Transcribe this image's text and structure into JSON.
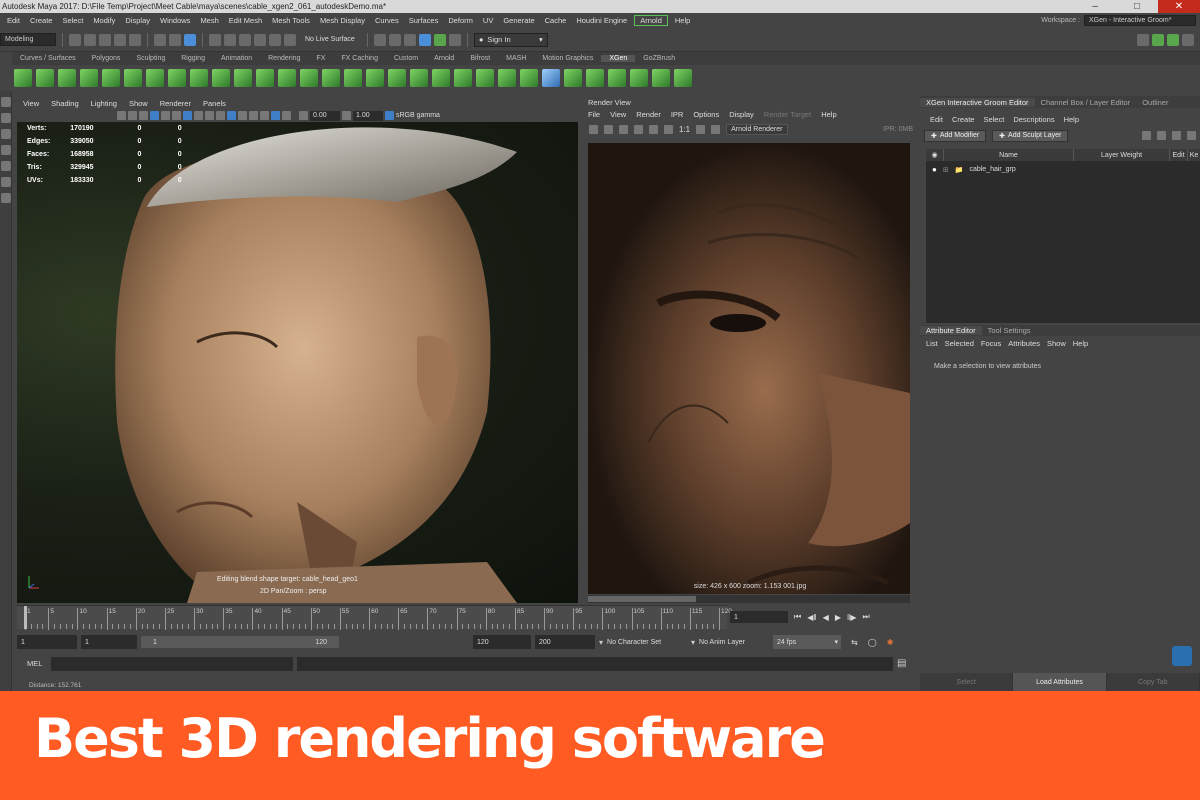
{
  "window": {
    "title": "Autodesk Maya 2017: D:\\File Temp\\Project\\Meet Cable\\maya\\scenes\\cable_xgen2_061_autodeskDemo.ma*"
  },
  "menubar": {
    "items": [
      "Edit",
      "Create",
      "Select",
      "Modify",
      "Display",
      "Windows",
      "Mesh",
      "Edit Mesh",
      "Mesh Tools",
      "Mesh Display",
      "Curves",
      "Surfaces",
      "Deform",
      "UV",
      "Generate",
      "Cache",
      "Houdini Engine"
    ],
    "arnold": "Arnold",
    "help": "Help",
    "workspace_label": "Workspace :",
    "workspace_value": "XGen - Interactive Groom*"
  },
  "statusline": {
    "mode": "Modeling",
    "live_surface": "No Live Surface",
    "sign_in": "Sign In"
  },
  "shelf": {
    "tabs": [
      "Curves / Surfaces",
      "Polygons",
      "Sculpting",
      "Rigging",
      "Animation",
      "Rendering",
      "FX",
      "FX Caching",
      "Custom",
      "Arnold",
      "Bifrost",
      "MASH",
      "Motion Graphics",
      "XGen",
      "GoZBrush"
    ],
    "active": "XGen"
  },
  "viewport": {
    "menu": [
      "View",
      "Shading",
      "Lighting",
      "Show",
      "Renderer",
      "Panels"
    ],
    "exposure": "0.00",
    "gamma": "1.00",
    "colorspace": "sRGB gamma",
    "hud": [
      {
        "label": "Verts:",
        "value": "170190",
        "a": "0",
        "b": "0"
      },
      {
        "label": "Edges:",
        "value": "339050",
        "a": "0",
        "b": "0"
      },
      {
        "label": "Faces:",
        "value": "168958",
        "a": "0",
        "b": "0"
      },
      {
        "label": "Tris:",
        "value": "329945",
        "a": "0",
        "b": "0"
      },
      {
        "label": "UVs:",
        "value": "183330",
        "a": "0",
        "b": "0"
      }
    ],
    "caption1": "Editing blend shape target: cable_head_geo1",
    "caption2": "2D Pan/Zoom : persp"
  },
  "renderview": {
    "title": "Render View",
    "menu": [
      "File",
      "View",
      "Render",
      "IPR",
      "Options",
      "Display",
      "Render Target",
      "Help"
    ],
    "ratio": "1:1",
    "renderer": "Arnold Renderer",
    "ipr": "IPR: 0MB",
    "status": "size: 426 x 600 zoom: 1.153 001.jpg"
  },
  "rightpanel": {
    "tabs": [
      "XGen Interactive Groom Editor",
      "Channel Box / Layer Editor",
      "Outliner"
    ],
    "menu": [
      "Edit",
      "Create",
      "Select",
      "Descriptions",
      "Help"
    ],
    "add_modifier": "Add Modifier",
    "add_sculpt_layer": "Add Sculpt Layer",
    "columns": [
      "Name",
      "Layer Weight",
      "Edit",
      "Ke"
    ],
    "item": "cable_hair_grp"
  },
  "attribute_editor": {
    "tabs": [
      "Attribute Editor",
      "Tool Settings"
    ],
    "menu": [
      "List",
      "Selected",
      "Focus",
      "Attributes",
      "Show",
      "Help"
    ],
    "message": "Make a selection to view attributes",
    "footer": [
      "Select",
      "Load Attributes",
      "Copy Tab"
    ]
  },
  "timeline": {
    "ticks": [
      "1",
      "5",
      "10",
      "15",
      "20",
      "25",
      "30",
      "35",
      "40",
      "45",
      "50",
      "55",
      "60",
      "65",
      "70",
      "75",
      "80",
      "85",
      "90",
      "95",
      "100",
      "105",
      "110",
      "115",
      "120"
    ],
    "current_frame": "1"
  },
  "range": {
    "start": "1",
    "playback_start": "1",
    "slider_start": "1",
    "slider_end": "120",
    "playback_end": "120",
    "end": "200",
    "character_set": "No Character Set",
    "anim_layer": "No Anim Layer",
    "fps": "24 fps"
  },
  "cmdline": {
    "label": "MEL",
    "help": "Distance:    152.761"
  },
  "banner": {
    "text": "Best 3D rendering software",
    "color": "#ff5b23"
  }
}
